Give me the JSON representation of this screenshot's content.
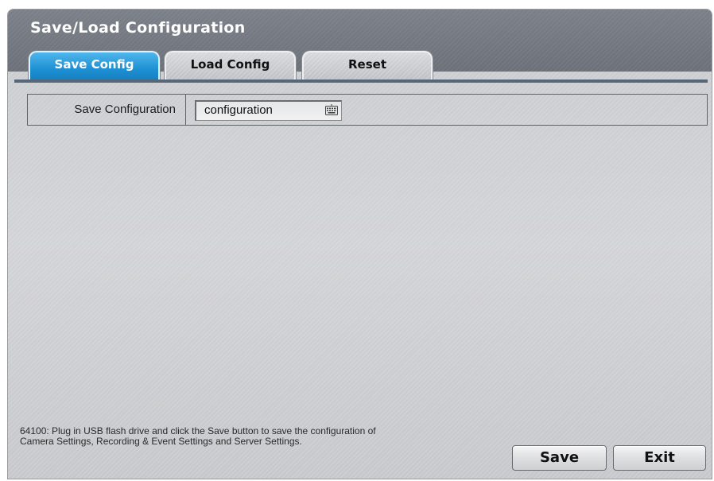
{
  "window": {
    "title": "Save/Load Configuration"
  },
  "tabs": [
    {
      "label": "Save Config",
      "active": true
    },
    {
      "label": "Load Config",
      "active": false
    },
    {
      "label": "Reset",
      "active": false
    }
  ],
  "form": {
    "save_configuration_label": "Save Configuration",
    "filename_value": "configuration",
    "keyboard_icon": "keyboard-icon"
  },
  "help_text": "64100: Plug in USB flash drive and click the Save button to save the configuration of Camera Settings, Recording & Event Settings and Server Settings.",
  "buttons": {
    "save_label": "Save",
    "exit_label": "Exit"
  },
  "colors": {
    "active_tab": "#1d8fd2",
    "titlebar": "#737882",
    "tab_divider": "#56677a"
  }
}
